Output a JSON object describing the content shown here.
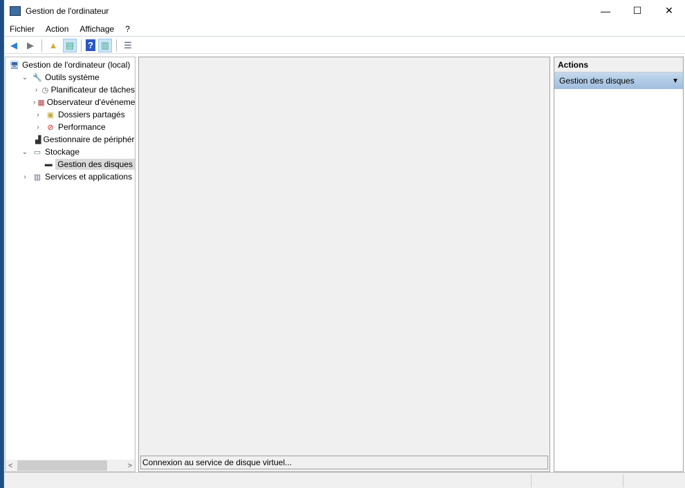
{
  "window": {
    "title": "Gestion de l'ordinateur",
    "minimize": "—",
    "maximize": "☐",
    "close": "✕"
  },
  "menu": [
    "Fichier",
    "Action",
    "Affichage",
    "?"
  ],
  "tree": [
    {
      "label": "Gestion de l'ordinateur (local)",
      "level": 0,
      "expander": "",
      "icon": "computer-management-icon"
    },
    {
      "label": "Outils système",
      "level": 1,
      "expander": "open",
      "icon": "tools-icon"
    },
    {
      "label": "Planificateur de tâches",
      "level": 2,
      "expander": "closed",
      "icon": "clock-icon"
    },
    {
      "label": "Observateur d'événements",
      "level": 2,
      "expander": "closed",
      "icon": "event-viewer-icon"
    },
    {
      "label": "Dossiers partagés",
      "level": 2,
      "expander": "closed",
      "icon": "shared-folder-icon"
    },
    {
      "label": "Performance",
      "level": 2,
      "expander": "closed",
      "icon": "performance-icon"
    },
    {
      "label": "Gestionnaire de périphériques",
      "level": 2,
      "expander": "",
      "icon": "device-manager-icon"
    },
    {
      "label": "Stockage",
      "level": 1,
      "expander": "open",
      "icon": "storage-icon"
    },
    {
      "label": "Gestion des disques",
      "level": 2,
      "expander": "",
      "icon": "disk-icon",
      "selected": true
    },
    {
      "label": "Services et applications",
      "level": 1,
      "expander": "closed",
      "icon": "services-icon"
    }
  ],
  "center": {
    "status": "Connexion au service de disque virtuel..."
  },
  "actions": {
    "header": "Actions",
    "item": "Gestion des disques"
  }
}
